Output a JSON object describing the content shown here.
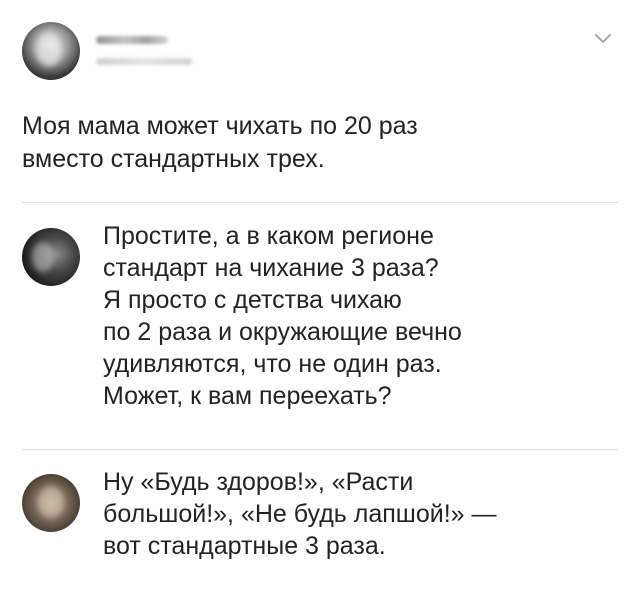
{
  "post": {
    "text": "Моя мама может чихать по 20 раз\nвместо стандартных трех."
  },
  "comments": [
    {
      "text": "Простите, а в каком регионе\nстандарт на чихание 3 раза?\nЯ просто с детства чихаю\nпо 2 раза и окружающие вечно\nудивляются, что не один раз.\nМожет, к вам переехать?"
    },
    {
      "text": "Ну «Будь здоров!», «Расти\nбольшой!», «Не будь лапшой!» —\nвот стандартные 3 раза."
    }
  ],
  "icons": {
    "menu": "chevron-down-icon"
  },
  "colors": {
    "text": "#232323",
    "divider": "#e4e4e4",
    "chevron": "#9aa0a6"
  }
}
